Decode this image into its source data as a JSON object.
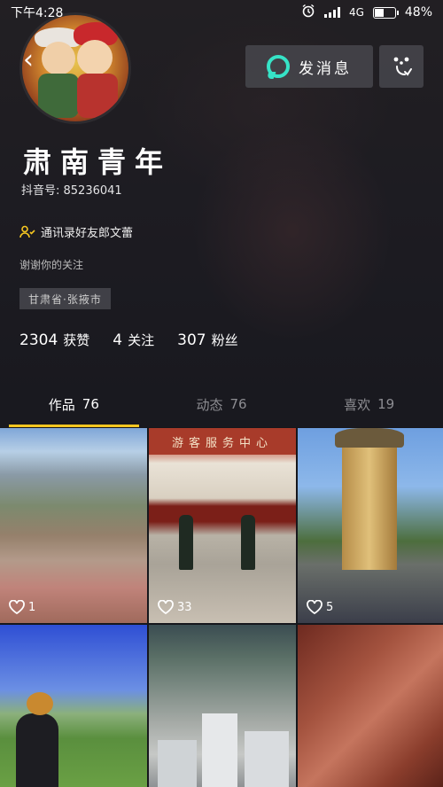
{
  "status_bar": {
    "time": "下午4:28",
    "network": "4G",
    "battery": "48%",
    "battery_level": 0.48
  },
  "profile": {
    "name": "肃南青年",
    "douyin_id": "抖音号: 85236041",
    "verify_text": "通讯录好友郎文蕾",
    "bio": "谢谢你的关注",
    "location": "甘肃省·张掖市"
  },
  "actions": {
    "message_label": "发消息"
  },
  "stats": [
    {
      "value": "2304",
      "label": "获赞"
    },
    {
      "value": "4",
      "label": "关注"
    },
    {
      "value": "307",
      "label": "粉丝"
    }
  ],
  "tabs": [
    {
      "label": "作品",
      "count": "76",
      "active": true
    },
    {
      "label": "动态",
      "count": "76",
      "active": false
    },
    {
      "label": "喜欢",
      "count": "19",
      "active": false
    }
  ],
  "videos": [
    {
      "likes": "1"
    },
    {
      "likes": "33",
      "sign": "游客服务中心"
    },
    {
      "likes": "5"
    },
    {
      "likes": ""
    },
    {
      "likes": ""
    },
    {
      "likes": ""
    }
  ],
  "colors": {
    "accent_tab": "#f5c621",
    "message_icon": "#36e3c7",
    "background": "#16171c"
  },
  "icons": {
    "status": [
      "alarm-icon",
      "signal-icon",
      "battery-icon"
    ],
    "back": "back-arrow-icon",
    "message": "chat-bubble-icon",
    "follow": "add-friend-icon",
    "verify": "friends-icon",
    "like": "heart-icon"
  }
}
